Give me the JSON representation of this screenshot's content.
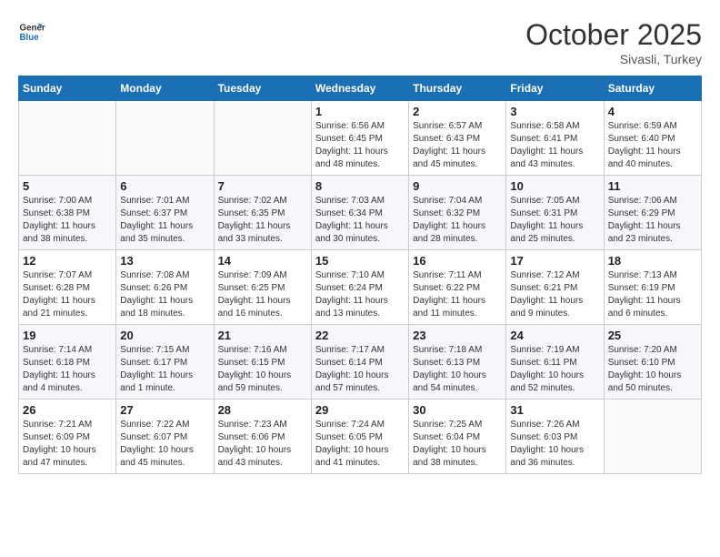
{
  "header": {
    "logo_line1": "General",
    "logo_line2": "Blue",
    "month": "October 2025",
    "location": "Sivasli, Turkey"
  },
  "weekdays": [
    "Sunday",
    "Monday",
    "Tuesday",
    "Wednesday",
    "Thursday",
    "Friday",
    "Saturday"
  ],
  "weeks": [
    [
      {
        "day": "",
        "info": ""
      },
      {
        "day": "",
        "info": ""
      },
      {
        "day": "",
        "info": ""
      },
      {
        "day": "1",
        "info": "Sunrise: 6:56 AM\nSunset: 6:45 PM\nDaylight: 11 hours\nand 48 minutes."
      },
      {
        "day": "2",
        "info": "Sunrise: 6:57 AM\nSunset: 6:43 PM\nDaylight: 11 hours\nand 45 minutes."
      },
      {
        "day": "3",
        "info": "Sunrise: 6:58 AM\nSunset: 6:41 PM\nDaylight: 11 hours\nand 43 minutes."
      },
      {
        "day": "4",
        "info": "Sunrise: 6:59 AM\nSunset: 6:40 PM\nDaylight: 11 hours\nand 40 minutes."
      }
    ],
    [
      {
        "day": "5",
        "info": "Sunrise: 7:00 AM\nSunset: 6:38 PM\nDaylight: 11 hours\nand 38 minutes."
      },
      {
        "day": "6",
        "info": "Sunrise: 7:01 AM\nSunset: 6:37 PM\nDaylight: 11 hours\nand 35 minutes."
      },
      {
        "day": "7",
        "info": "Sunrise: 7:02 AM\nSunset: 6:35 PM\nDaylight: 11 hours\nand 33 minutes."
      },
      {
        "day": "8",
        "info": "Sunrise: 7:03 AM\nSunset: 6:34 PM\nDaylight: 11 hours\nand 30 minutes."
      },
      {
        "day": "9",
        "info": "Sunrise: 7:04 AM\nSunset: 6:32 PM\nDaylight: 11 hours\nand 28 minutes."
      },
      {
        "day": "10",
        "info": "Sunrise: 7:05 AM\nSunset: 6:31 PM\nDaylight: 11 hours\nand 25 minutes."
      },
      {
        "day": "11",
        "info": "Sunrise: 7:06 AM\nSunset: 6:29 PM\nDaylight: 11 hours\nand 23 minutes."
      }
    ],
    [
      {
        "day": "12",
        "info": "Sunrise: 7:07 AM\nSunset: 6:28 PM\nDaylight: 11 hours\nand 21 minutes."
      },
      {
        "day": "13",
        "info": "Sunrise: 7:08 AM\nSunset: 6:26 PM\nDaylight: 11 hours\nand 18 minutes."
      },
      {
        "day": "14",
        "info": "Sunrise: 7:09 AM\nSunset: 6:25 PM\nDaylight: 11 hours\nand 16 minutes."
      },
      {
        "day": "15",
        "info": "Sunrise: 7:10 AM\nSunset: 6:24 PM\nDaylight: 11 hours\nand 13 minutes."
      },
      {
        "day": "16",
        "info": "Sunrise: 7:11 AM\nSunset: 6:22 PM\nDaylight: 11 hours\nand 11 minutes."
      },
      {
        "day": "17",
        "info": "Sunrise: 7:12 AM\nSunset: 6:21 PM\nDaylight: 11 hours\nand 9 minutes."
      },
      {
        "day": "18",
        "info": "Sunrise: 7:13 AM\nSunset: 6:19 PM\nDaylight: 11 hours\nand 6 minutes."
      }
    ],
    [
      {
        "day": "19",
        "info": "Sunrise: 7:14 AM\nSunset: 6:18 PM\nDaylight: 11 hours\nand 4 minutes."
      },
      {
        "day": "20",
        "info": "Sunrise: 7:15 AM\nSunset: 6:17 PM\nDaylight: 11 hours\nand 1 minute."
      },
      {
        "day": "21",
        "info": "Sunrise: 7:16 AM\nSunset: 6:15 PM\nDaylight: 10 hours\nand 59 minutes."
      },
      {
        "day": "22",
        "info": "Sunrise: 7:17 AM\nSunset: 6:14 PM\nDaylight: 10 hours\nand 57 minutes."
      },
      {
        "day": "23",
        "info": "Sunrise: 7:18 AM\nSunset: 6:13 PM\nDaylight: 10 hours\nand 54 minutes."
      },
      {
        "day": "24",
        "info": "Sunrise: 7:19 AM\nSunset: 6:11 PM\nDaylight: 10 hours\nand 52 minutes."
      },
      {
        "day": "25",
        "info": "Sunrise: 7:20 AM\nSunset: 6:10 PM\nDaylight: 10 hours\nand 50 minutes."
      }
    ],
    [
      {
        "day": "26",
        "info": "Sunrise: 7:21 AM\nSunset: 6:09 PM\nDaylight: 10 hours\nand 47 minutes."
      },
      {
        "day": "27",
        "info": "Sunrise: 7:22 AM\nSunset: 6:07 PM\nDaylight: 10 hours\nand 45 minutes."
      },
      {
        "day": "28",
        "info": "Sunrise: 7:23 AM\nSunset: 6:06 PM\nDaylight: 10 hours\nand 43 minutes."
      },
      {
        "day": "29",
        "info": "Sunrise: 7:24 AM\nSunset: 6:05 PM\nDaylight: 10 hours\nand 41 minutes."
      },
      {
        "day": "30",
        "info": "Sunrise: 7:25 AM\nSunset: 6:04 PM\nDaylight: 10 hours\nand 38 minutes."
      },
      {
        "day": "31",
        "info": "Sunrise: 7:26 AM\nSunset: 6:03 PM\nDaylight: 10 hours\nand 36 minutes."
      },
      {
        "day": "",
        "info": ""
      }
    ]
  ]
}
